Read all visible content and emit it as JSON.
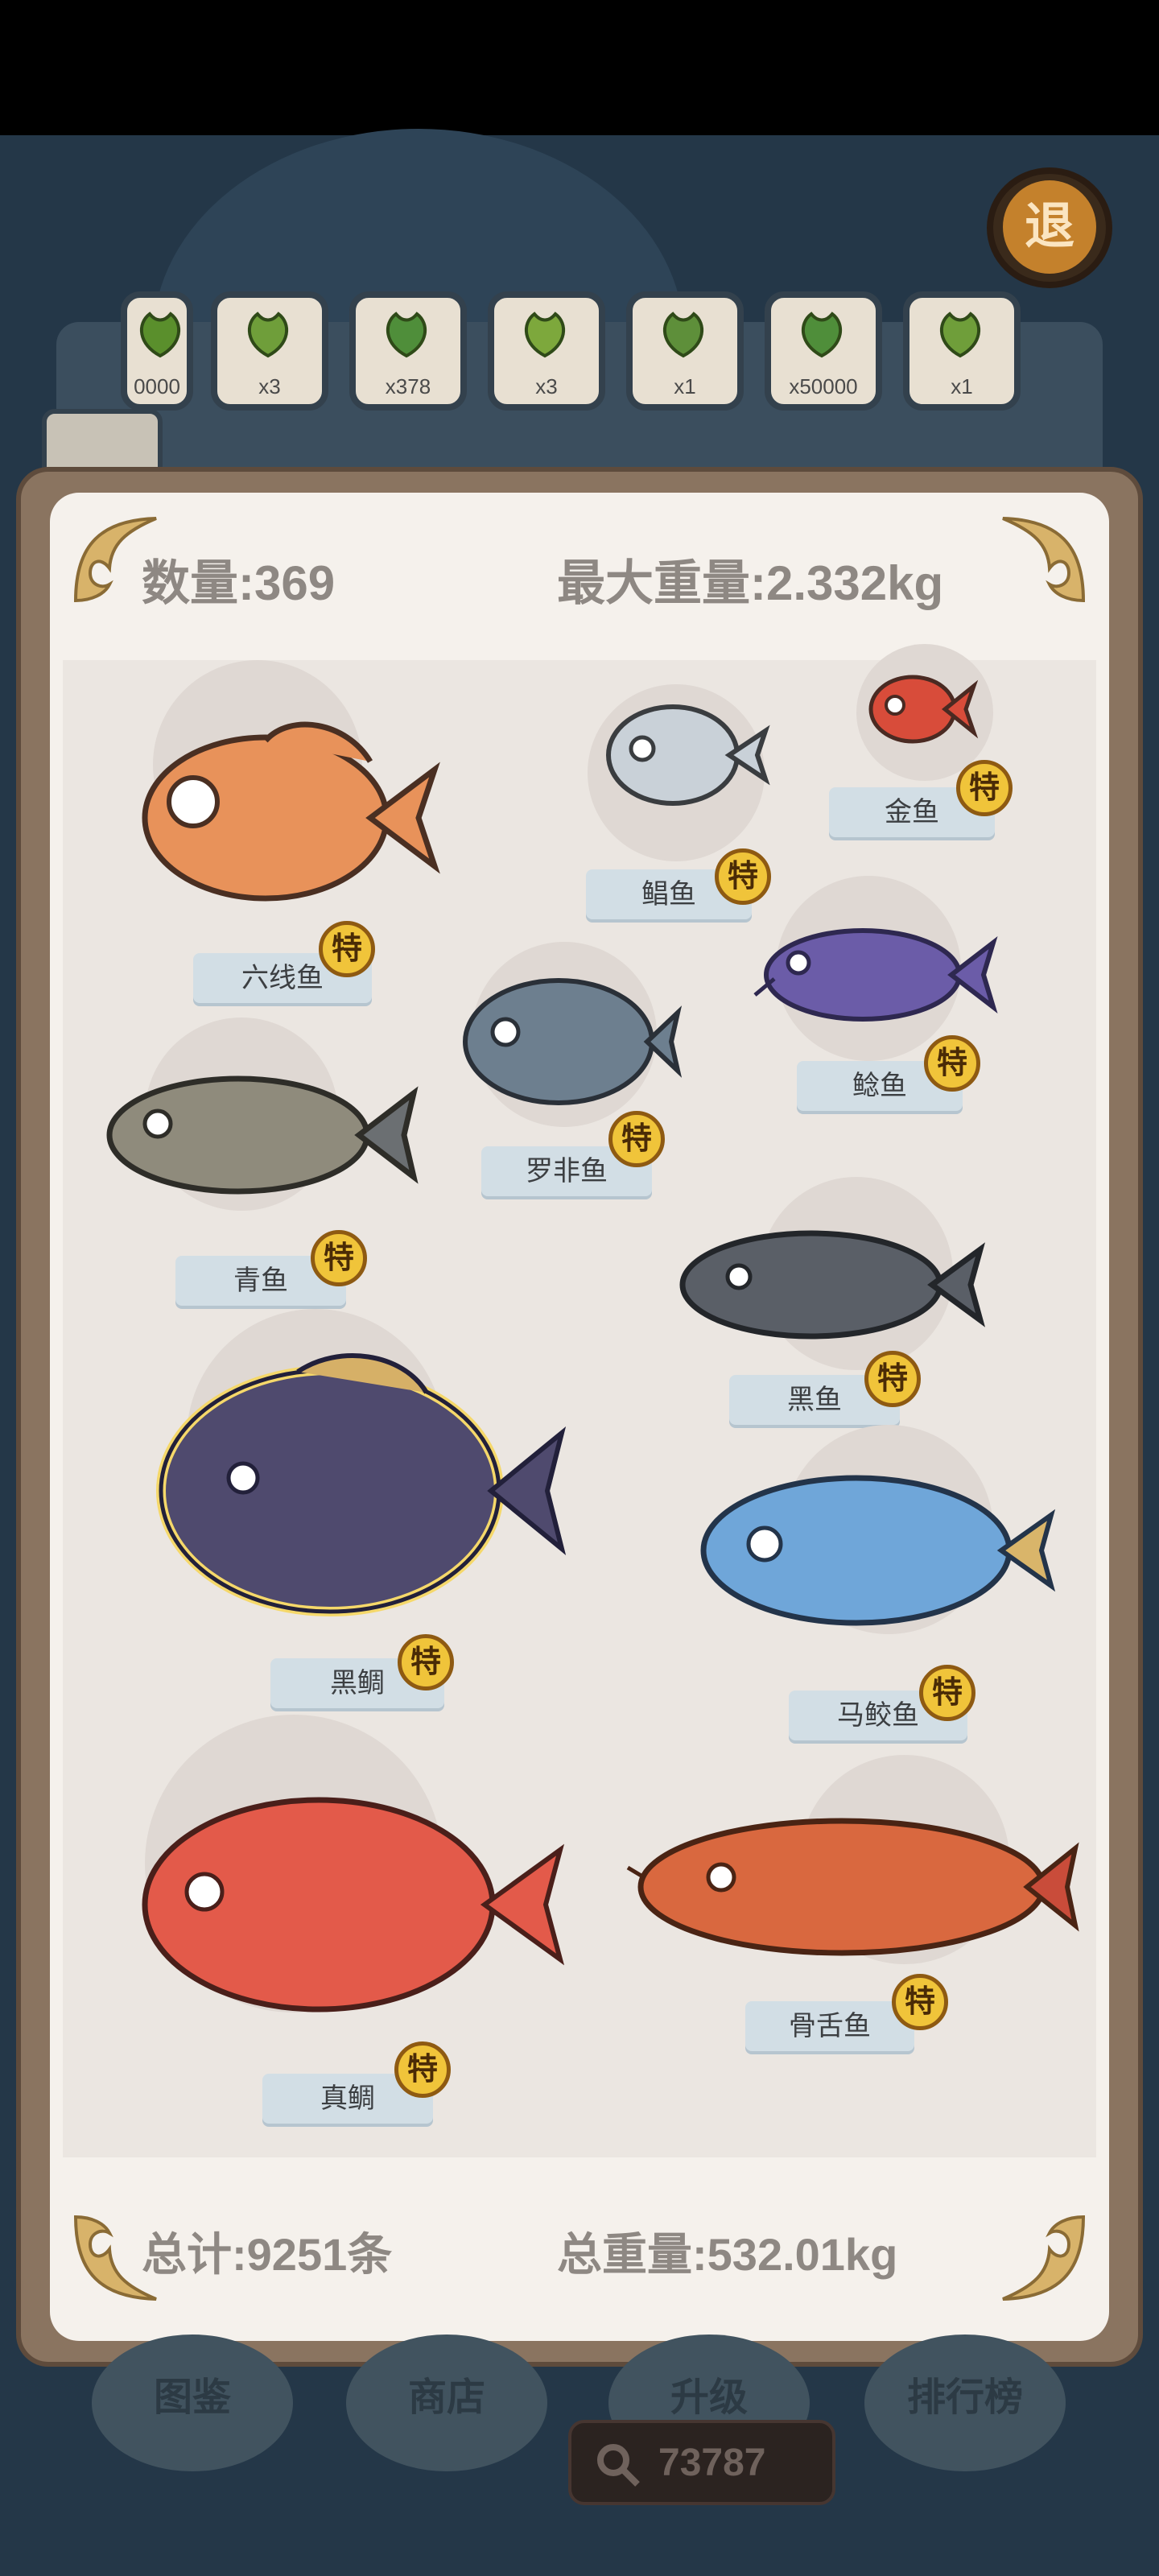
{
  "header": {
    "exit_label": "退"
  },
  "collection_items": [
    {
      "qty": "0000"
    },
    {
      "qty": "x3"
    },
    {
      "qty": "x378"
    },
    {
      "qty": "x3"
    },
    {
      "qty": "x1"
    },
    {
      "qty": "x50000"
    },
    {
      "qty": "x1"
    }
  ],
  "panel": {
    "count_label": "数量:369",
    "max_weight_label": "最大重量:2.332kg",
    "total_count_label": "总计:9251条",
    "total_weight_label": "总重量:532.01kg",
    "special_badge": "特"
  },
  "fish": [
    {
      "name": "六线鱼",
      "color": "#e8925a"
    },
    {
      "name": "鲳鱼",
      "color": "#c9d1d8"
    },
    {
      "name": "金鱼",
      "color": "#d84c3a"
    },
    {
      "name": "鲶鱼",
      "color": "#6b5ca8"
    },
    {
      "name": "罗非鱼",
      "color": "#6d7f8f"
    },
    {
      "name": "青鱼",
      "color": "#8f8b7c"
    },
    {
      "name": "黑鱼",
      "color": "#5a5f67"
    },
    {
      "name": "黑鲷",
      "color": "#4f4a6e"
    },
    {
      "name": "马鲛鱼",
      "color": "#6fa6d9"
    },
    {
      "name": "真鲷",
      "color": "#e35a4a"
    },
    {
      "name": "骨舌鱼",
      "color": "#d9683f"
    }
  ],
  "bottom_nav": [
    {
      "label": "图鉴"
    },
    {
      "label": "商店"
    },
    {
      "label": "升级"
    },
    {
      "label": "排行榜"
    }
  ],
  "currency": {
    "amount": "73787"
  }
}
